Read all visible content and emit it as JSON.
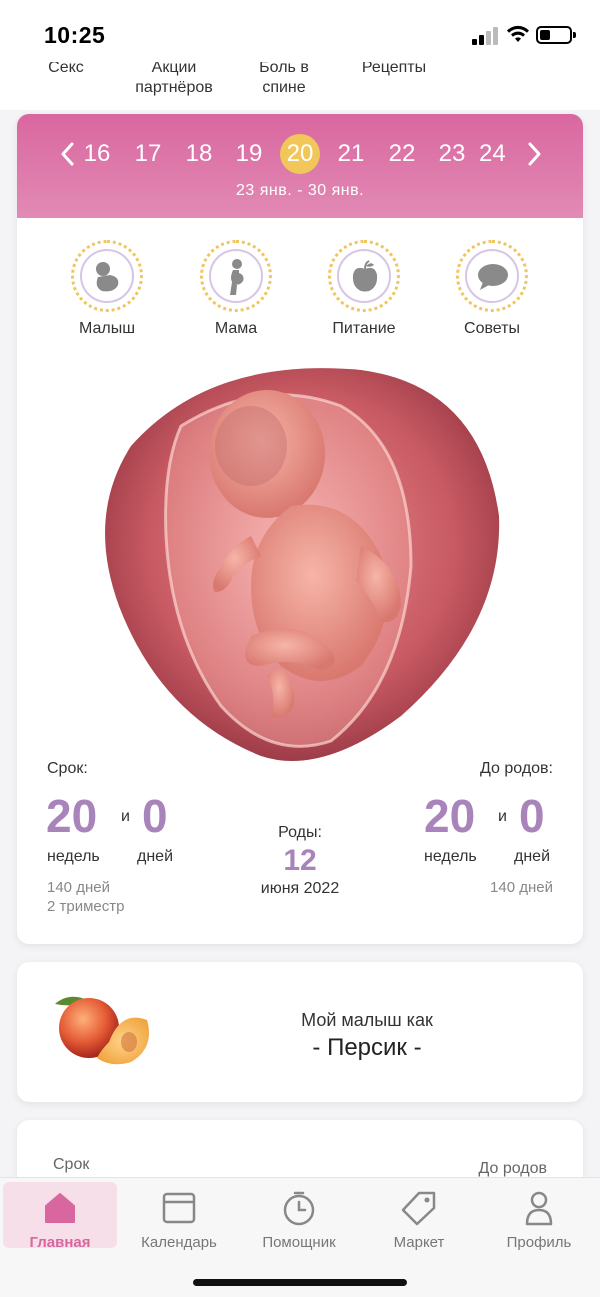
{
  "status_bar": {
    "time": "10:25"
  },
  "categories": [
    {
      "line1": "Секс",
      "line2": ""
    },
    {
      "line1": "Акции",
      "line2": "партнёров"
    },
    {
      "line1": "Боль в",
      "line2": "спине"
    },
    {
      "line1": "Рецепты",
      "line2": ""
    }
  ],
  "weeks": {
    "items": [
      "16",
      "17",
      "18",
      "19",
      "20",
      "21",
      "22",
      "23",
      "24"
    ],
    "active": "20",
    "range": "23 янв. - 30 янв."
  },
  "tabs": [
    {
      "label": "Малыш",
      "icon": "baby-icon"
    },
    {
      "label": "Мама",
      "icon": "pregnant-icon"
    },
    {
      "label": "Питание",
      "icon": "apple-icon"
    },
    {
      "label": "Советы",
      "icon": "chat-bubble-icon"
    }
  ],
  "stats": {
    "term_label": "Срок:",
    "term_weeks": "20",
    "term_days": "0",
    "and": "и",
    "weeks_label": "недель",
    "days_label": "дней",
    "term_total": "140 дней",
    "trimester": "2 триместр",
    "birth_label": "Роды:",
    "birth_day": "12",
    "birth_month": "июня 2022",
    "until_label": "До родов:",
    "until_weeks": "20",
    "until_days": "0",
    "until_total": "140 дней"
  },
  "fruit": {
    "caption": "Мой малыш как",
    "name": "- Персик -",
    "icon": "peach-icon"
  },
  "next_card": {
    "left_label": "Срок",
    "right_label": "До родов"
  },
  "nav": [
    {
      "label": "Главная",
      "icon": "home-icon",
      "active": true
    },
    {
      "label": "Календарь",
      "icon": "calendar-icon",
      "active": false
    },
    {
      "label": "Помощник",
      "icon": "timer-icon",
      "active": false
    },
    {
      "label": "Маркет",
      "icon": "tag-icon",
      "active": false
    },
    {
      "label": "Профиль",
      "icon": "profile-icon",
      "active": false
    }
  ],
  "colors": {
    "accent": "#d9679f",
    "highlight": "#f1c75a",
    "number": "#a884bb"
  }
}
